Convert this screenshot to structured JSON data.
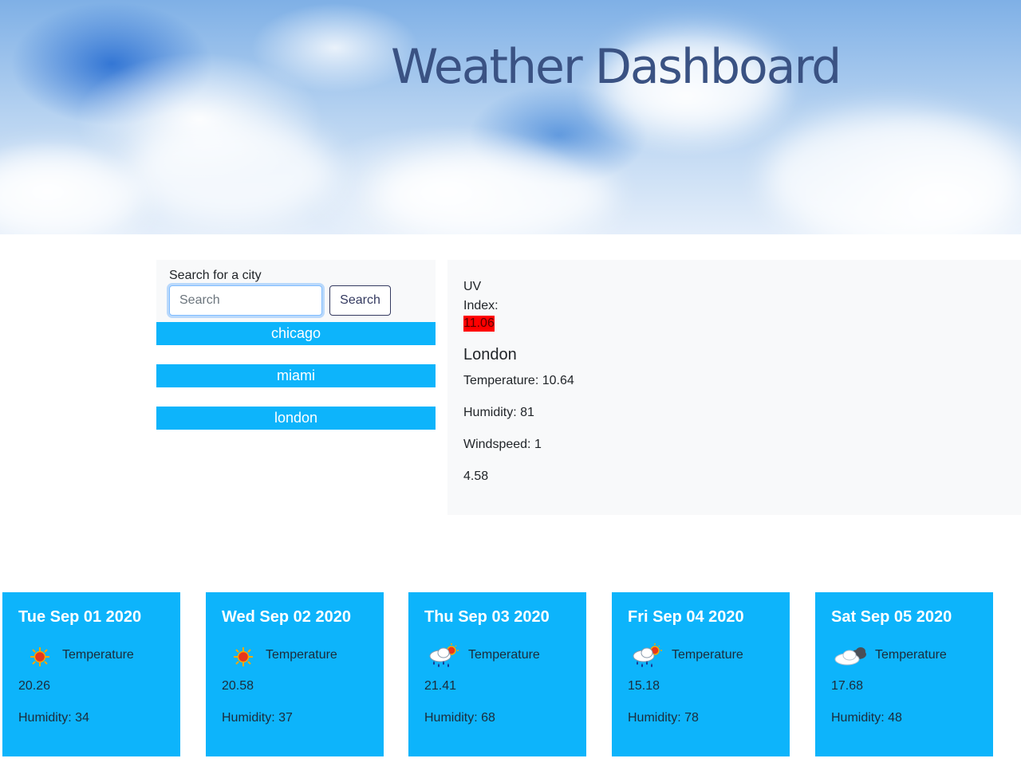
{
  "header": {
    "title": "Weather Dashboard"
  },
  "search": {
    "label": "Search for a city",
    "placeholder": "Search",
    "button_label": "Search"
  },
  "history": [
    {
      "label": "chicago"
    },
    {
      "label": "miami"
    },
    {
      "label": "london"
    }
  ],
  "current": {
    "uv_label": "UV Index:",
    "uv_value": "11.06",
    "city": "London",
    "temperature": "Temperature: 10.64",
    "humidity": "Humidity: 81",
    "windspeed": "Windspeed: 1",
    "extra": "4.58"
  },
  "forecast": [
    {
      "date": "Tue Sep 01 2020",
      "icon": "sun-icon",
      "temp_label": "Temperature",
      "temp": "20.26",
      "humidity": "Humidity: 34"
    },
    {
      "date": "Wed Sep 02 2020",
      "icon": "sun-icon",
      "temp_label": "Temperature",
      "temp": "20.58",
      "humidity": "Humidity: 37"
    },
    {
      "date": "Thu Sep 03 2020",
      "icon": "rain-sun-icon",
      "temp_label": "Temperature",
      "temp": "21.41",
      "humidity": "Humidity: 68"
    },
    {
      "date": "Fri Sep 04 2020",
      "icon": "rain-sun-icon",
      "temp_label": "Temperature",
      "temp": "15.18",
      "humidity": "Humidity: 78"
    },
    {
      "date": "Sat Sep 05 2020",
      "icon": "cloud-icon",
      "temp_label": "Temperature",
      "temp": "17.68",
      "humidity": "Humidity: 48"
    }
  ],
  "colors": {
    "accent": "#0db4fb",
    "uv_badge": "#ff0000",
    "title": "#3a5283",
    "panel": "#f8f9fa"
  }
}
